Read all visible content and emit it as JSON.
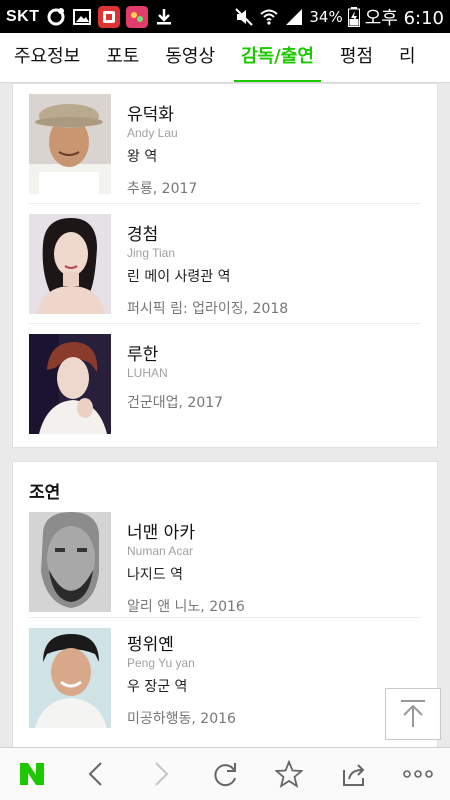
{
  "status_bar": {
    "carrier": "SKT",
    "battery": "34%",
    "time": "오후 6:10"
  },
  "tabs": [
    {
      "label": "주요정보",
      "active": false
    },
    {
      "label": "포토",
      "active": false
    },
    {
      "label": "동영상",
      "active": false
    },
    {
      "label": "감독/출연",
      "active": true
    },
    {
      "label": "평점",
      "active": false
    },
    {
      "label": "리",
      "active": false
    }
  ],
  "main_cast": [
    {
      "name": "유덕화",
      "english_name": "Andy Lau",
      "role": "왕 역",
      "work": "추룡, 2017"
    },
    {
      "name": "경첨",
      "english_name": "Jing Tian",
      "role": "린 메이 사령관 역",
      "work": "퍼시픽 림: 업라이징, 2018"
    },
    {
      "name": "루한",
      "english_name": "LUHAN",
      "role": "",
      "work": "건군대업, 2017"
    }
  ],
  "supporting_section": {
    "title": "조연"
  },
  "supporting_cast": [
    {
      "name": "너맨 아카",
      "english_name": "Numan Acar",
      "role": "나지드 역",
      "work": "알리 앤 니노, 2016"
    },
    {
      "name": "펑위옌",
      "english_name": "Peng Yu yan",
      "role": "우 장군 역",
      "work": "미공하행동, 2016"
    }
  ],
  "colors": {
    "accent": "#1ec800"
  },
  "bottom_nav": [
    "naver-home",
    "back",
    "forward",
    "refresh",
    "bookmark",
    "share",
    "more"
  ]
}
